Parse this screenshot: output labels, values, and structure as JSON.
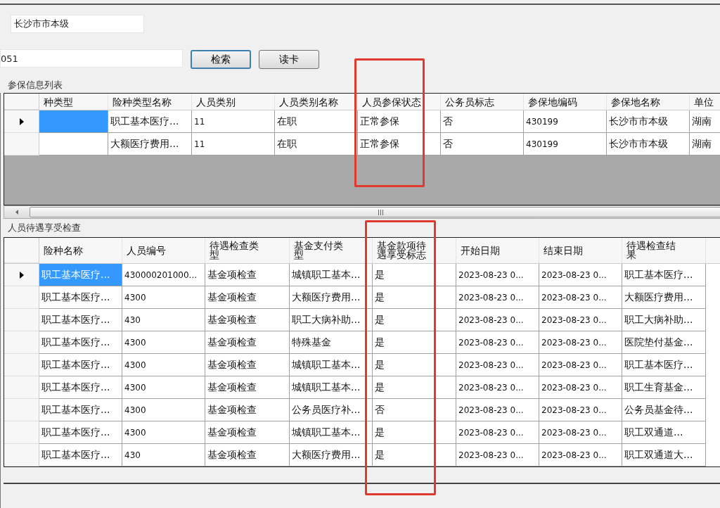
{
  "form": {
    "region_field": {
      "value": "长沙市市本级"
    },
    "id_field": {
      "value": "051"
    },
    "buttons": [
      {
        "label": "检索",
        "focused": true
      },
      {
        "label": "读卡",
        "focused": false
      }
    ]
  },
  "insurance_list": {
    "title": "参保信息列表",
    "columns": [
      {
        "label": "种类型"
      },
      {
        "label": "险种类型名称"
      },
      {
        "label": "人员类别"
      },
      {
        "label": "人员类别名称"
      },
      {
        "label": "人员参保状态"
      },
      {
        "label": "公务员标志"
      },
      {
        "label": "参保地编码"
      },
      {
        "label": "参保地名称"
      },
      {
        "label": "单位"
      }
    ],
    "rows": [
      {
        "current": true,
        "selected": true,
        "cells": [
          null,
          "职工基本医疗...",
          "11",
          "在职",
          "正常参保",
          "否",
          "430199",
          "长沙市市本级",
          "湖南"
        ]
      },
      {
        "current": false,
        "selected": false,
        "cells": [
          null,
          "大额医疗费用...",
          "11",
          "在职",
          "正常参保",
          "否",
          "430199",
          "长沙市市本级",
          "湖南"
        ]
      }
    ]
  },
  "benefit_check": {
    "title": "人员待遇享受检查",
    "columns": [
      {
        "label": "险种名称"
      },
      {
        "label": "人员编号"
      },
      {
        "label": "待遇检查类型"
      },
      {
        "label": "基金支付类型"
      },
      {
        "label": "基金款项待遇享受标志"
      },
      {
        "label": "开始日期"
      },
      {
        "label": "结束日期"
      },
      {
        "label": "待遇检查结果"
      }
    ],
    "rows": [
      {
        "current": true,
        "selected": true,
        "cells": [
          "职工基本医疗...",
          "430000201000...",
          "基金项检查",
          "城镇职工基本...",
          "是",
          "2023-08-23 0...",
          "2023-08-23 0...",
          "职工基本医疗..."
        ]
      },
      {
        "current": false,
        "selected": false,
        "cells": [
          "职工基本医疗...",
          "4300",
          "基金项检查",
          "大额医疗费用...",
          "是",
          "2023-08-23 0...",
          "2023-08-23 0...",
          "大额医疗费用..."
        ]
      },
      {
        "current": false,
        "selected": false,
        "cells": [
          "职工基本医疗...",
          "430",
          "基金项检查",
          "职工大病补助...",
          "是",
          "2023-08-23 0...",
          "2023-08-23 0...",
          "职工大病补助..."
        ]
      },
      {
        "current": false,
        "selected": false,
        "cells": [
          "职工基本医疗...",
          "4300",
          "基金项检查",
          "特殊基金",
          "是",
          "2023-08-23 0...",
          "2023-08-23 0...",
          "医院垫付基金..."
        ]
      },
      {
        "current": false,
        "selected": false,
        "cells": [
          "职工基本医疗...",
          "4300",
          "基金项检查",
          "城镇职工基本...",
          "是",
          "2023-08-23 0...",
          "2023-08-23 0...",
          "职工基本医疗..."
        ]
      },
      {
        "current": false,
        "selected": false,
        "cells": [
          "职工基本医疗...",
          "4300",
          "基金项检查",
          "城镇职工基本...",
          "是",
          "2023-08-23 0...",
          "2023-08-23 0...",
          "职工生育基金..."
        ]
      },
      {
        "current": false,
        "selected": false,
        "cells": [
          "职工基本医疗...",
          "4300",
          "基金项检查",
          "公务员医疗补...",
          "否",
          "2023-08-23 0...",
          "2023-08-23 0...",
          "公务员基金待..."
        ]
      },
      {
        "current": false,
        "selected": false,
        "cells": [
          "职工基本医疗...",
          "4300",
          "基金项检查",
          "城镇职工基本...",
          "是",
          "2023-08-23 0...",
          "2023-08-23 0...",
          "职工双通道..."
        ]
      },
      {
        "current": false,
        "selected": false,
        "cells": [
          "职工基本医疗...",
          "430",
          "基金项检查",
          "大额医疗费用...",
          "是",
          "2023-08-23 0...",
          "2023-08-23 0...",
          "职工双通道大..."
        ]
      }
    ]
  }
}
